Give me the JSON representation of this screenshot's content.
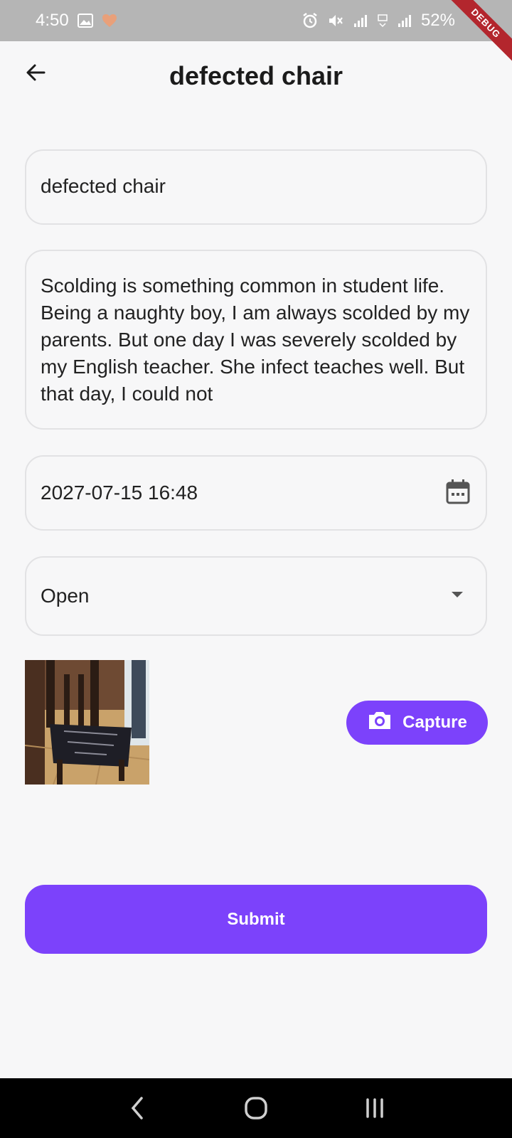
{
  "status_bar": {
    "time": "4:50",
    "battery": "52%"
  },
  "debug_badge": "DEBUG",
  "app_bar": {
    "title": "defected chair"
  },
  "form": {
    "title_value": "defected chair",
    "description_value": "Scolding is something common in student life. Being a naughty boy, I am always scolded by my parents. But one day I was severely scolded by my English teacher. She infect teaches well. But that day, I could not",
    "date_value": "2027-07-15 16:48",
    "status_value": "Open"
  },
  "actions": {
    "capture_label": "Capture",
    "submit_label": "Submit"
  },
  "colors": {
    "accent": "#7c42fb",
    "status_bar": "#b5b5b5",
    "background": "#f7f7f8"
  },
  "icons": {
    "back": "arrow-left-icon",
    "calendar": "calendar-icon",
    "dropdown": "caret-down-icon",
    "camera": "camera-icon"
  }
}
